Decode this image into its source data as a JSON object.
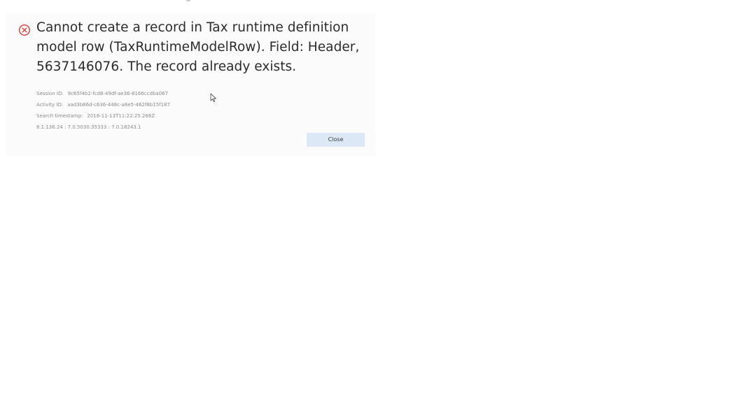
{
  "dialog": {
    "icon": "error-circle-x-icon",
    "message": "Cannot create a record in Tax runtime definition model row (TaxRuntimeModelRow). Field: Header, 5637146076. The record already exists.",
    "details": {
      "session_label": "Session ID:",
      "session_value": "9c65f4b2-fcd8-49df-ae36-8166ccdba067",
      "activity_label": "Activity ID:",
      "activity_value": "aad3b86d-c636-448c-a8e5-462f8b15f187",
      "timestamp_label": "Search timestamp:",
      "timestamp_value": "2018-11-13T11:22:25.268Z",
      "version": "8.1.136.24 : 7.0.5030.35333 : 7.0.18243.1"
    },
    "close_label": "Close"
  },
  "colors": {
    "error": "#d83b3b",
    "button_bg": "#dce8f6",
    "text": "#2b2b2b",
    "muted_text": "#8a8a8a"
  },
  "cursor": "mouse-pointer-icon"
}
